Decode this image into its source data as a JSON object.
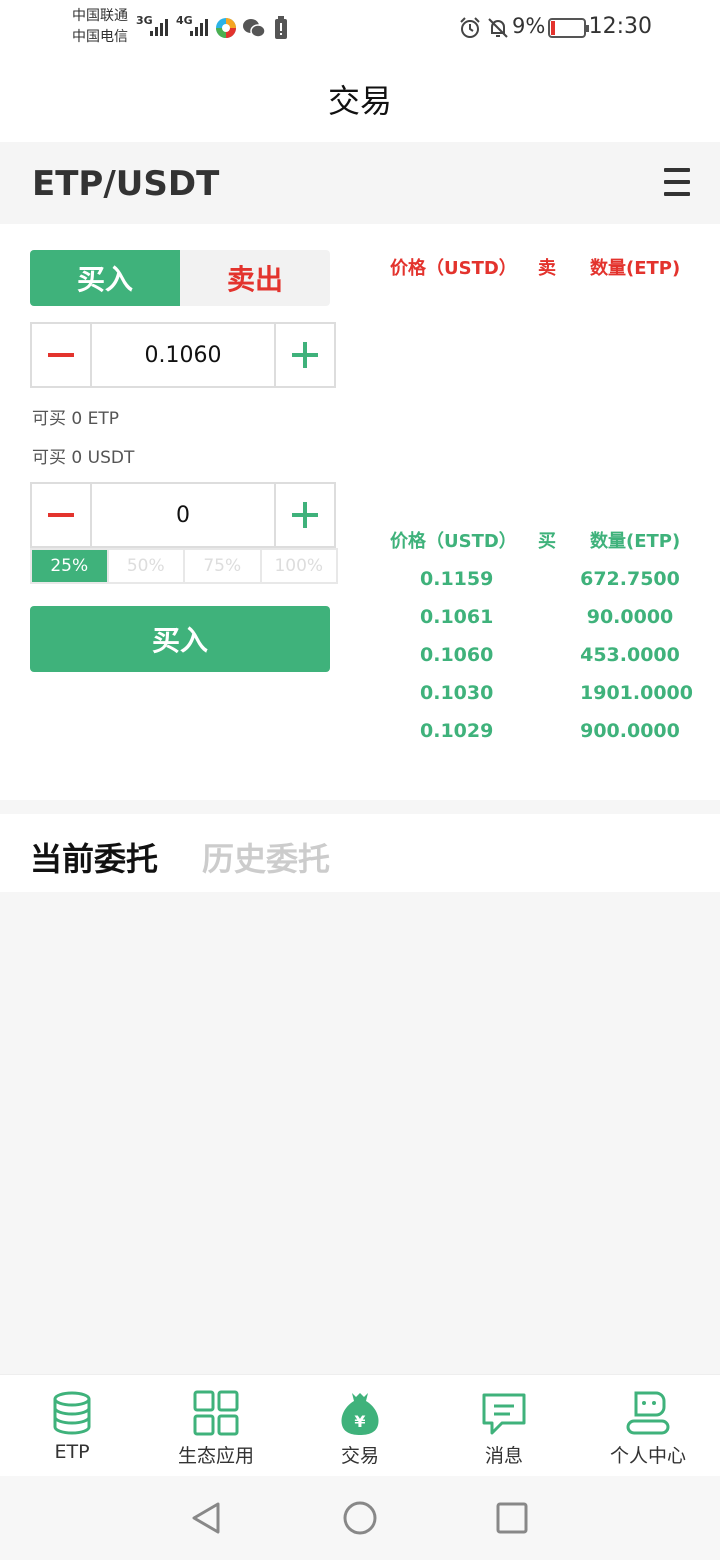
{
  "status_bar": {
    "carrier_1": "中国联通",
    "carrier_2": "中国电信",
    "signal_1": "3G",
    "signal_2": "4G",
    "battery_percent": "9%",
    "time": "12:30"
  },
  "header": {
    "title": "交易"
  },
  "pair": {
    "name": "ETP/USDT"
  },
  "trade_tabs": {
    "buy_label": "买入",
    "sell_label": "卖出"
  },
  "price_stepper": {
    "value": "0.1060"
  },
  "available": {
    "etp": "可买 0 ETP",
    "usdt": "可买 0 USDT"
  },
  "amount_stepper": {
    "value": "0"
  },
  "percent_options": [
    "25%",
    "50%",
    "75%",
    "100%"
  ],
  "submit": {
    "label": "买入"
  },
  "order_book": {
    "sell_header": {
      "price": "价格（USTD）",
      "side": "卖",
      "qty": "数量(ETP)"
    },
    "buy_header": {
      "price": "价格（USTD）",
      "side": "买",
      "qty": "数量(ETP)"
    },
    "buy_rows": [
      {
        "price": "0.1159",
        "qty": "672.7500"
      },
      {
        "price": "0.1061",
        "qty": "90.0000"
      },
      {
        "price": "0.1060",
        "qty": "453.0000"
      },
      {
        "price": "0.1030",
        "qty": "1901.0000"
      },
      {
        "price": "0.1029",
        "qty": "900.0000"
      }
    ]
  },
  "orders_tabs": {
    "current": "当前委托",
    "history": "历史委托"
  },
  "bottom_nav": [
    {
      "label": "ETP",
      "icon": "coins-icon"
    },
    {
      "label": "生态应用",
      "icon": "grid-icon"
    },
    {
      "label": "交易",
      "icon": "money-bag-icon"
    },
    {
      "label": "消息",
      "icon": "message-icon"
    },
    {
      "label": "个人中心",
      "icon": "user-icon"
    }
  ],
  "colors": {
    "green": "#3fb27b",
    "red": "#e3332d"
  }
}
